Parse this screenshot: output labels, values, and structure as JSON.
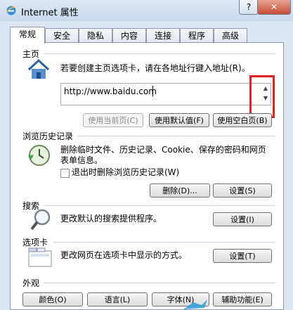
{
  "window": {
    "title": "Internet 属性",
    "help_label": "?",
    "close_label": "✕"
  },
  "tabs": [
    "常规",
    "安全",
    "隐私",
    "内容",
    "连接",
    "程序",
    "高级"
  ],
  "home": {
    "title": "主页",
    "desc": "若要创建主页选项卡，请在各地址行键入地址(R)。",
    "url": "http://www.baidu.com",
    "btn_current": "使用当前页(C)",
    "btn_default": "使用默认值(F)",
    "btn_blank": "使用空白页(B)"
  },
  "history": {
    "title": "浏览历史记录",
    "desc_line1": "删除临时文件、历史记录、Cookie、保存的密码和网页",
    "desc_line2": "表单信息。",
    "checkbox_label": "退出时删除浏览历史记录(W)",
    "checkbox_checked": false,
    "btn_delete": "删除(D)...",
    "btn_settings": "设置(S)"
  },
  "search": {
    "title": "搜索",
    "desc": "更改默认的搜索提供程序。",
    "btn_settings": "设置(I)"
  },
  "tabbed": {
    "title": "选项卡",
    "desc": "更改网页在选项卡中显示的方式。",
    "btn_settings": "设置(T)"
  },
  "appearance": {
    "title": "外观",
    "btn_colors": "颜色(O)",
    "btn_languages": "语言(L)",
    "btn_fonts": "字体(N)",
    "btn_accessibility": "辅助功能(E)"
  },
  "colors": {
    "accent": "#3a6ea5",
    "highlight": "#dd2222"
  }
}
